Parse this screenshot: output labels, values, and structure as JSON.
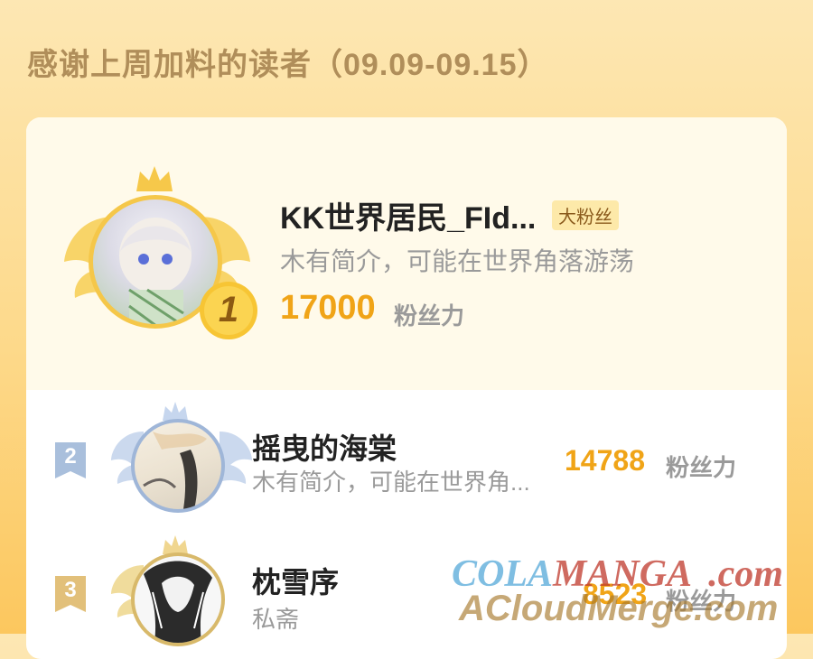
{
  "header": {
    "title": "感谢上周加料的读者（09.09-09.15）"
  },
  "ranking": [
    {
      "rank": "1",
      "name": "KK世界居民_FId...",
      "badge": "大粉丝",
      "intro": "木有简介，可能在世界角落游荡",
      "score": "17000",
      "unit": "粉丝力"
    },
    {
      "rank": "2",
      "name": "摇曳的海棠",
      "intro": "木有简介，可能在世界角...",
      "score": "14788",
      "unit": "粉丝力"
    },
    {
      "rank": "3",
      "name": "枕雪序",
      "intro": "私斋",
      "score": "8523",
      "unit": "粉丝力"
    }
  ],
  "watermark": {
    "line1_a": "COLA",
    "line1_b": "MANGA",
    "line1_c": ".com",
    "line2": "ACloudMerge.com"
  },
  "colors": {
    "gold": "#f0a417",
    "title": "#b08e5a",
    "silver": "#a9bfdc",
    "bronze": "#e2c07a"
  }
}
